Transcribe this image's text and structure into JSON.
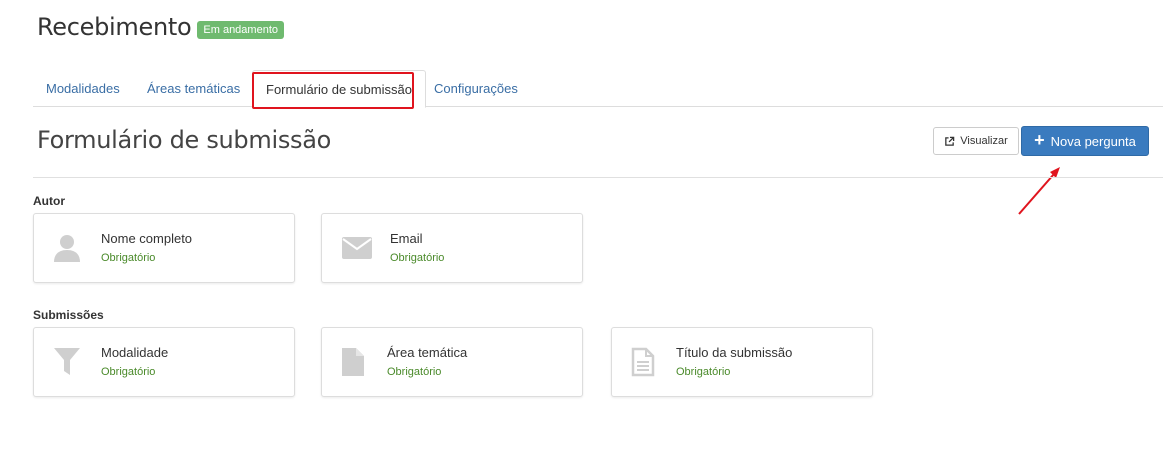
{
  "header": {
    "title": "Recebimento",
    "status_badge": "Em andamento"
  },
  "tabs": [
    {
      "label": "Modalidades"
    },
    {
      "label": "Áreas temáticas"
    },
    {
      "label": "Formulário de submissão",
      "active": true
    },
    {
      "label": "Configurações"
    }
  ],
  "section": {
    "title": "Formulário de submissão",
    "view_button": "Visualizar",
    "new_button": "Nova pergunta"
  },
  "groups": [
    {
      "label": "Autor",
      "fields": [
        {
          "name": "Nome completo",
          "required_text": "Obrigatório",
          "icon": "user-icon"
        },
        {
          "name": "Email",
          "required_text": "Obrigatório",
          "icon": "envelope-icon"
        }
      ]
    },
    {
      "label": "Submissões",
      "fields": [
        {
          "name": "Modalidade",
          "required_text": "Obrigatório",
          "icon": "filter-icon"
        },
        {
          "name": "Área temática",
          "required_text": "Obrigatório",
          "icon": "file-icon"
        },
        {
          "name": "Título da submissão",
          "required_text": "Obrigatório",
          "icon": "file-text-icon"
        }
      ]
    }
  ],
  "colors": {
    "link": "#3a6ea5",
    "primary_button": "#3a7bbf",
    "badge": "#6fba6f",
    "required_text": "#4a8a2a",
    "highlight": "#e0141e"
  }
}
